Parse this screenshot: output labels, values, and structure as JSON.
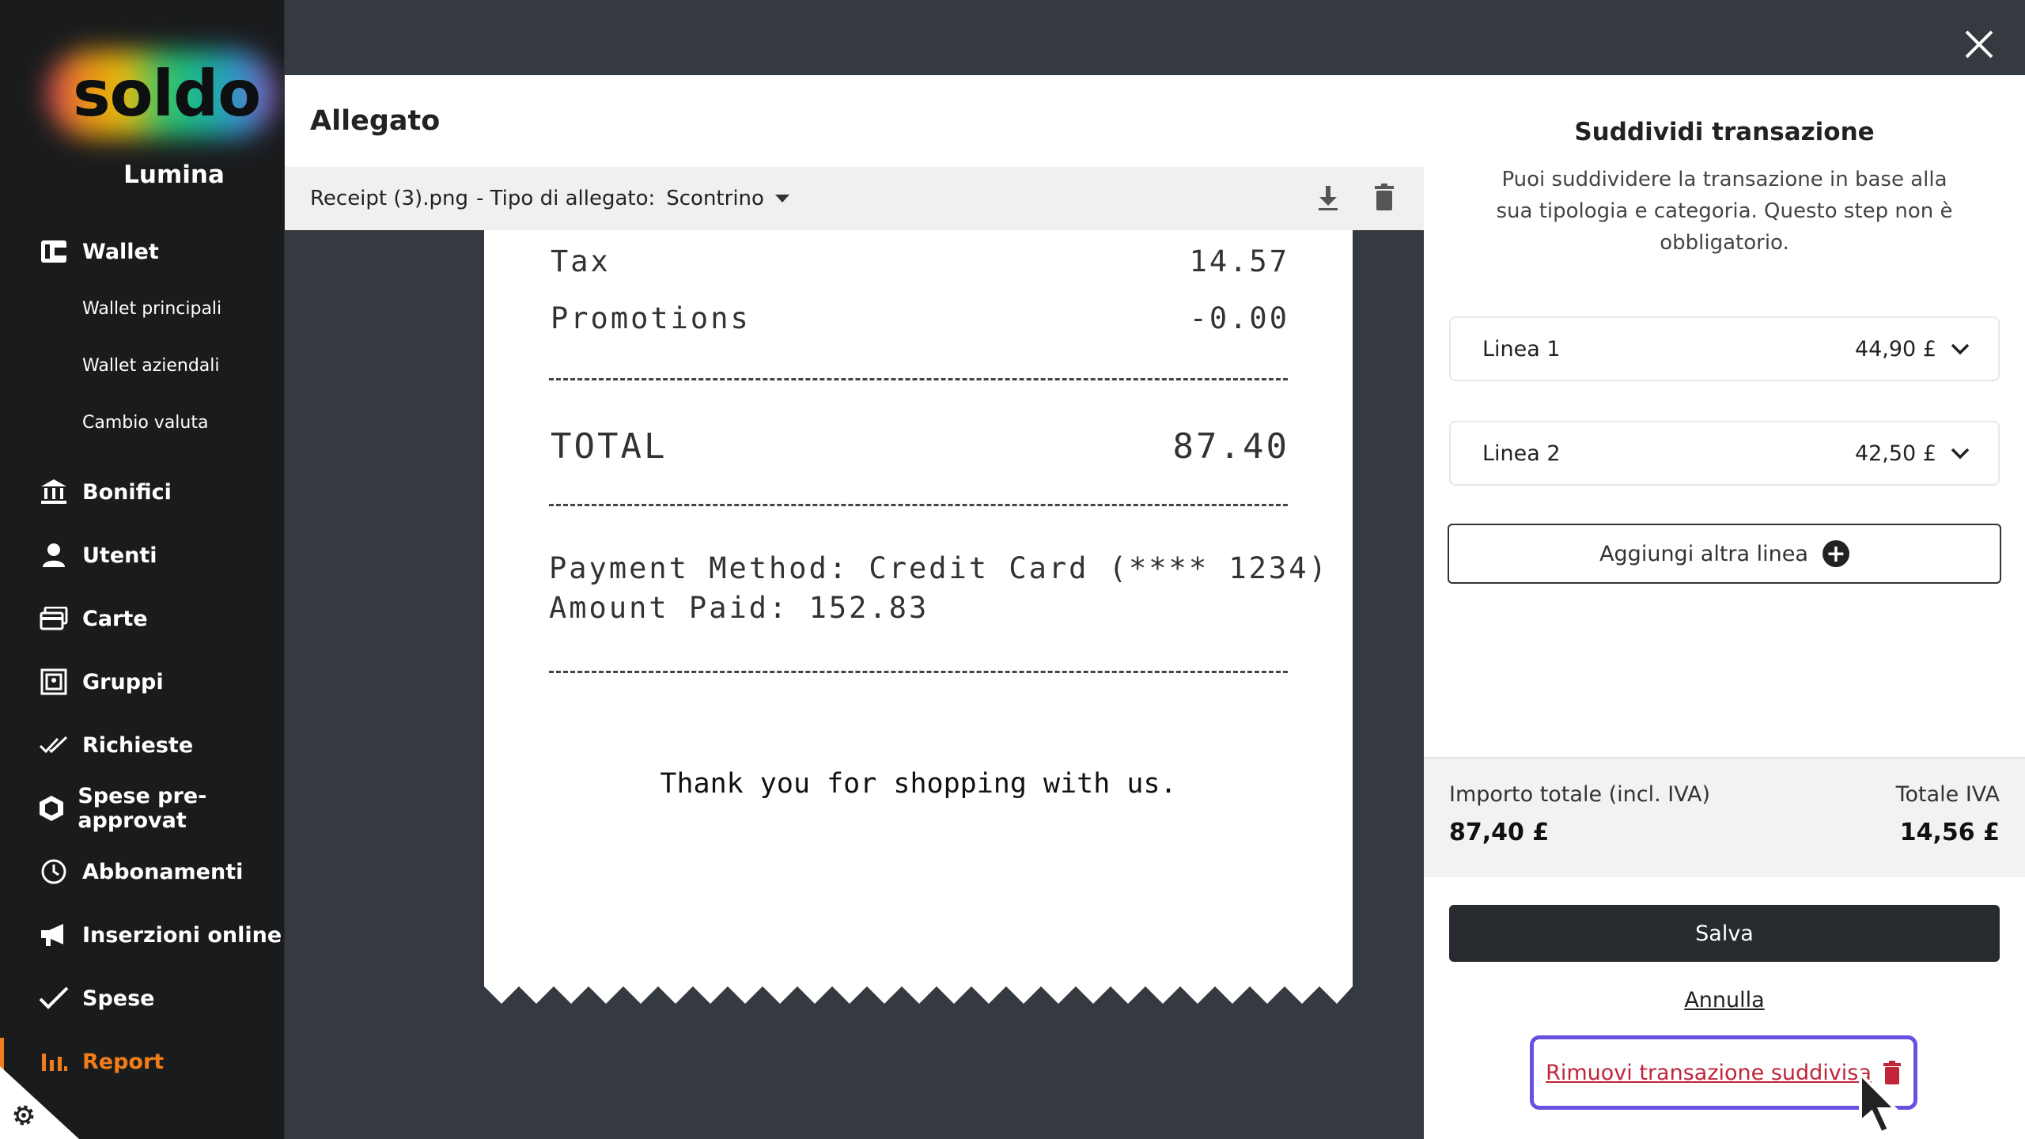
{
  "brand": {
    "logo_text": "soldo",
    "org_name": "Lumina"
  },
  "sidebar": {
    "wallet": "Wallet",
    "wallet_sub": [
      "Wallet principali",
      "Wallet aziendali",
      "Cambio valuta"
    ],
    "items": [
      {
        "label": "Bonifici",
        "icon": "bank-transfer-icon"
      },
      {
        "label": "Utenti",
        "icon": "user-icon"
      },
      {
        "label": "Carte",
        "icon": "cards-icon"
      },
      {
        "label": "Gruppi",
        "icon": "groups-icon"
      },
      {
        "label": "Richieste",
        "icon": "double-check-icon"
      },
      {
        "label": "Spese pre-approvat",
        "icon": "hexagon-icon"
      },
      {
        "label": "Abbonamenti",
        "icon": "clock-icon"
      },
      {
        "label": "Inserzioni online",
        "icon": "megaphone-icon"
      },
      {
        "label": "Spese",
        "icon": "check-icon"
      },
      {
        "label": "Report",
        "icon": "bar-chart-icon",
        "active": true
      }
    ],
    "active_color": "#f07d1a"
  },
  "attachment": {
    "title": "Allegato",
    "file_name": "Receipt (3).png",
    "type_label": "- Tipo di allegato:",
    "type_value": "Scontrino"
  },
  "receipt": {
    "tax_label": "Tax",
    "tax_value": "14.57",
    "promo_label": "Promotions",
    "promo_value": "-0.00",
    "total_label": "TOTAL",
    "total_value": "87.40",
    "payment_line": "Payment Method: Credit Card (**** 1234)",
    "paid_line": "Amount Paid: 152.83",
    "thanks": "Thank you for shopping with us."
  },
  "split": {
    "title": "Suddividi transazione",
    "description": "Puoi suddividere la transazione in base alla sua tipologia e categoria. Questo step non è obbligatorio.",
    "lines": [
      {
        "label": "Linea 1",
        "amount": "44,90 £"
      },
      {
        "label": "Linea 2",
        "amount": "42,50 £"
      }
    ],
    "add_line": "Aggiungi altra linea",
    "total_label": "Importo totale (incl. IVA)",
    "total_value": "87,40 £",
    "vat_label": "Totale IVA",
    "vat_value": "14,56 £",
    "save": "Salva",
    "cancel": "Annulla",
    "remove": "Rimuovi transazione suddivisa",
    "highlight_color": "#6b4fe0"
  }
}
